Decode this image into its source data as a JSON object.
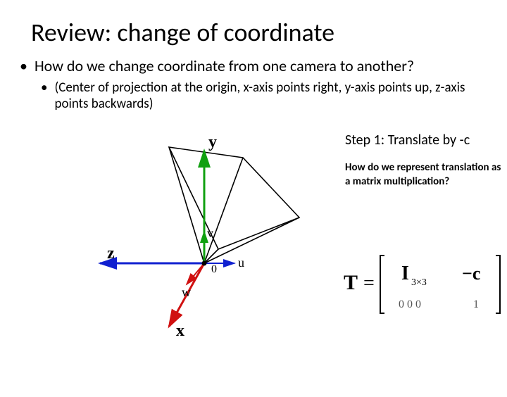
{
  "title": "Review: change of coordinate",
  "bullet1": "How do we change coordinate from one camera to another?",
  "bullet2": "(Center of projection at the origin, x-axis points right, y-axis points up, z-axis points backwards)",
  "step": "Step 1: Translate by -c",
  "question": "How do we represent translation as a matrix multiplication?",
  "axes": {
    "x": "x",
    "y": "y",
    "z": "z",
    "u": "u",
    "v": "v",
    "w": "w",
    "origin": "0"
  },
  "matrix": {
    "T": "T",
    "eq": "=",
    "I": "I",
    "Idim": "3×3",
    "negc": "−c",
    "row0": "0  0  0",
    "row1": "1"
  }
}
